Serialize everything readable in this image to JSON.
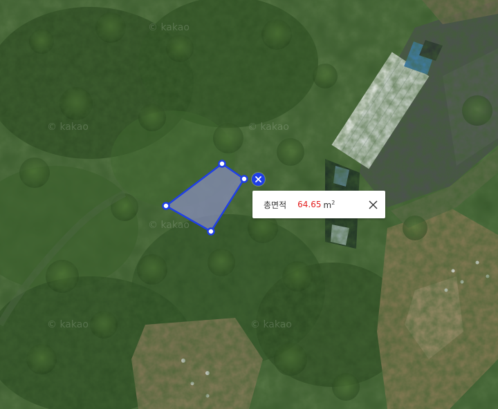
{
  "map": {
    "watermark": "© kakao",
    "tooltip": {
      "label": "총면적",
      "value": "64.65",
      "unit": "m",
      "unit_superscript": "2"
    },
    "colors": {
      "polygon_stroke": "#1f3fe6",
      "polygon_fill": "#8a8fbf",
      "value_text": "#e31c1c"
    },
    "icons": [
      "delete-icon",
      "close-icon"
    ]
  }
}
